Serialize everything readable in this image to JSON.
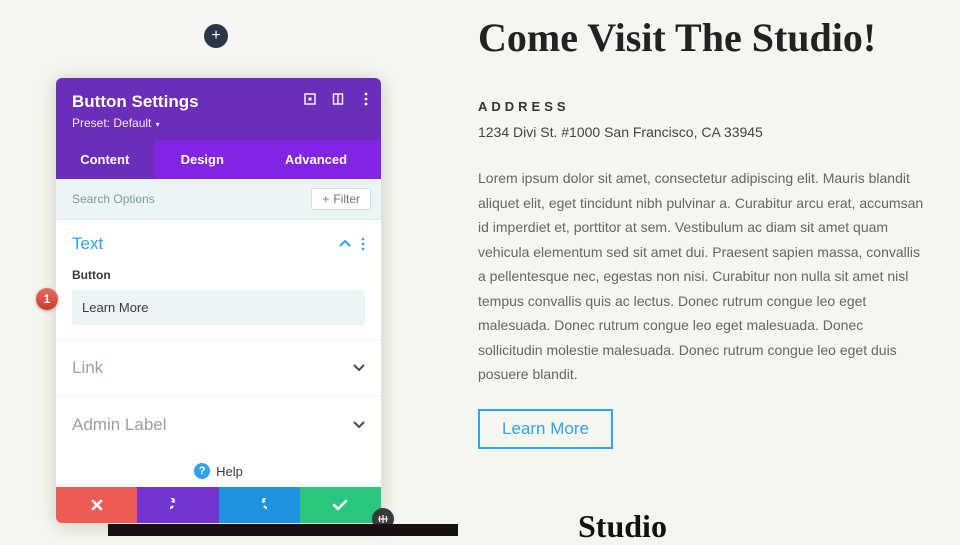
{
  "page": {
    "title": "Come Visit The Studio!",
    "address_label": "ADDRESS",
    "address_line": "1234 Divi St. #1000 San Francisco, CA 33945",
    "lorem": "Lorem ipsum dolor sit amet, consectetur adipiscing elit. Mauris blandit aliquet elit, eget tincidunt nibh pulvinar a. Curabitur arcu erat, accumsan id imperdiet et, porttitor at sem. Vestibulum ac diam sit amet quam vehicula elementum sed sit amet dui. Praesent sapien massa, convallis a pellentesque nec, egestas non nisi. Curabitur non nulla sit amet nisl tempus convallis quis ac lectus. Donec rutrum congue leo eget malesuada. Donec rutrum congue leo eget malesuada. Donec sollicitudin molestie malesuada. Donec rutrum congue leo eget duis posuere blandit.",
    "cta_label": "Learn More",
    "peek_text": "Studio"
  },
  "panel": {
    "title": "Button Settings",
    "preset_label": "Preset: Default",
    "tabs": {
      "content": "Content",
      "design": "Design",
      "advanced": "Advanced"
    },
    "search_placeholder": "Search Options",
    "filter_label": "Filter",
    "sections": {
      "text": {
        "title": "Text",
        "field_label": "Button",
        "field_value": "Learn More"
      },
      "link": {
        "title": "Link"
      },
      "admin_label": {
        "title": "Admin Label"
      }
    },
    "help_label": "Help"
  },
  "annotation": {
    "step1": "1"
  },
  "colors": {
    "purple_dark": "#6c2eb9",
    "purple": "#8224e3",
    "blue": "#2ea3f2",
    "red": "#ef5a55",
    "green": "#29c77e"
  }
}
